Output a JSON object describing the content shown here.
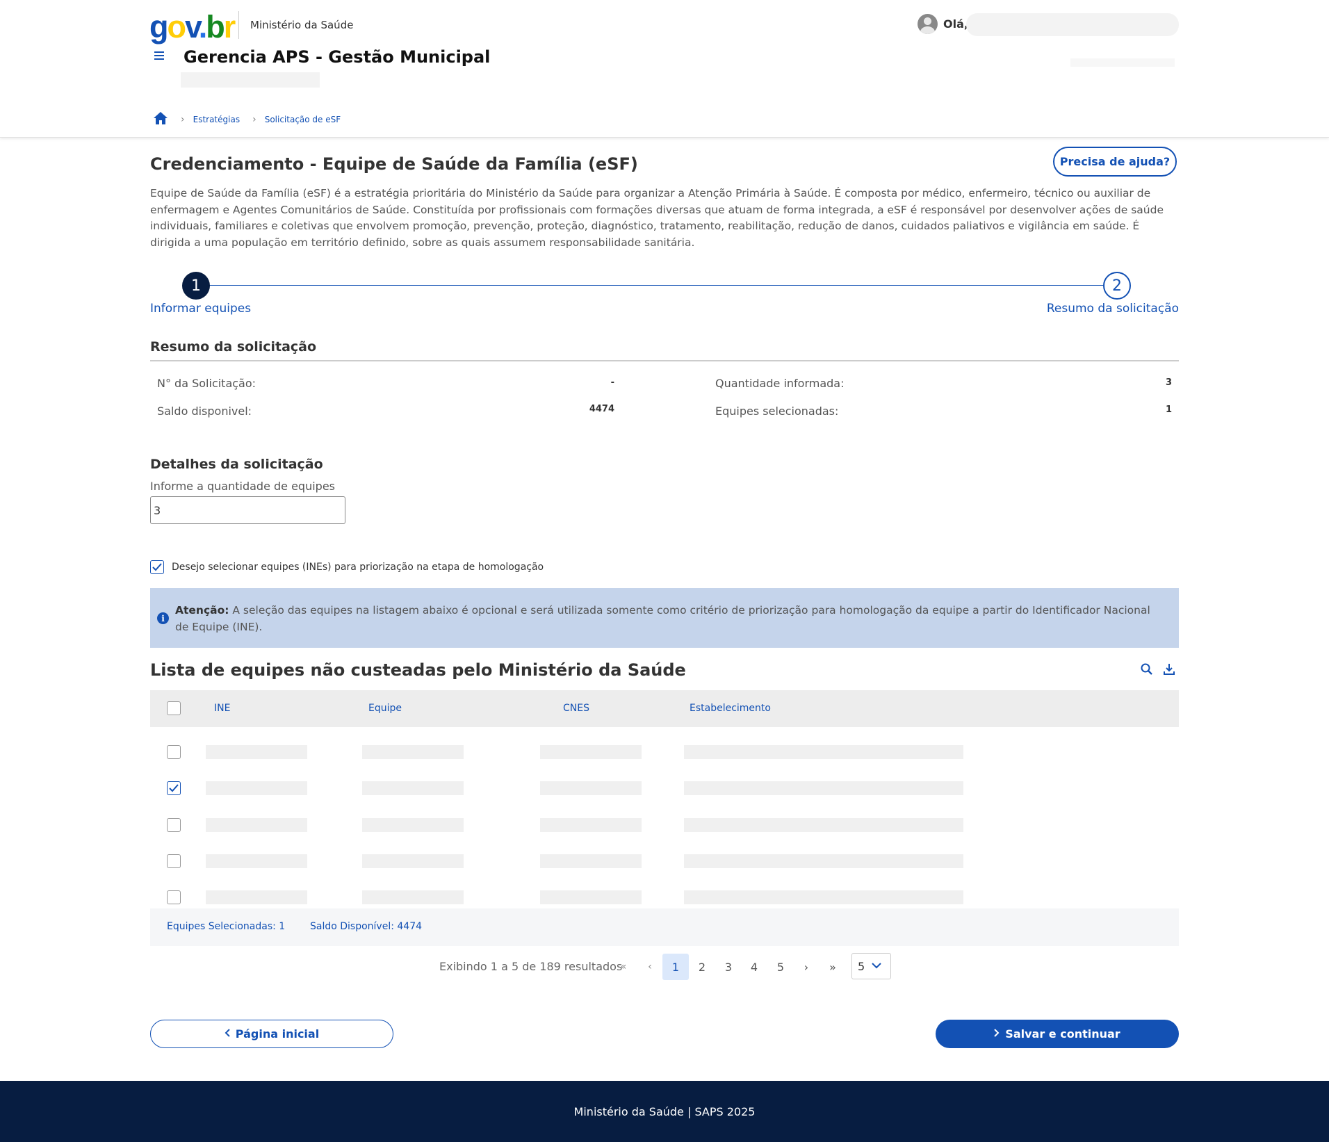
{
  "header": {
    "logo": {
      "g": "g",
      "o": "o",
      "v": "v",
      "dot": ".",
      "b": "b",
      "r": "r"
    },
    "org": "Ministério da Saúde",
    "greeting": "Olá,",
    "app_title": "Gerencia APS - Gestão Municipal",
    "menu_icon": "hamburger-icon",
    "breadcrumb": [
      "Estratégias",
      "Solicitação de eSF"
    ]
  },
  "page": {
    "title": "Credenciamento - Equipe de Saúde da Família (eSF)",
    "help_button": "Precisa de ajuda?",
    "description": "Equipe de Saúde da Família (eSF) é a estratégia prioritária do Ministério da Saúde para organizar a Atenção Primária à Saúde. É composta por médico, enfermeiro, técnico ou auxiliar de enfermagem e Agentes Comunitários de Saúde. Constituída por profissionais com formações diversas que atuam de forma integrada, a eSF é responsável por desenvolver ações de saúde individuais, familiares e coletivas que envolvem promoção, prevenção, proteção, diagnóstico, tratamento, reabilitação, redução de danos, cuidados paliativos e vigilância em saúde. É dirigida a uma população em território definido, sobre as quais assumem responsabilidade sanitária."
  },
  "stepper": {
    "steps": [
      {
        "number": "1",
        "label": "Informar equipes",
        "active": true
      },
      {
        "number": "2",
        "label": "Resumo da solicitação",
        "active": false
      }
    ]
  },
  "summary": {
    "title": "Resumo da solicitação",
    "request_number_label": "N° da Solicitação:",
    "request_number_value": "-",
    "balance_label": "Saldo disponivel:",
    "balance_value": "4474",
    "informed_label": "Quantidade informada:",
    "informed_value": "3",
    "selected_label": "Equipes selecionadas:",
    "selected_value": "1"
  },
  "details": {
    "title": "Detalhes da solicitação",
    "quantity_label": "Informe a quantidade de equipes",
    "quantity_value": "3",
    "prioritize_label": "Desejo selecionar equipes (INEs) para priorização na etapa de homologação",
    "prioritize_checked": true
  },
  "alert": {
    "icon": "info-icon",
    "bold": "Atenção:",
    "text": " A seleção das equipes na listagem abaixo é opcional e será utilizada somente como critério de priorização para homologação da equipe a partir do Identificador Nacional de Equipe (INE)."
  },
  "list": {
    "title": "Lista de equipes não custeadas pelo Ministério da Saúde",
    "icons": [
      "search-icon",
      "download-icon"
    ],
    "columns": [
      "INE",
      "Equipe",
      "CNES",
      "Estabelecimento"
    ],
    "rows": [
      {
        "checked": false
      },
      {
        "checked": true
      },
      {
        "checked": false
      },
      {
        "checked": false
      },
      {
        "checked": false
      }
    ],
    "footer_selected": "Equipes Selecionadas: 1",
    "footer_balance": "Saldo Disponível: 4474"
  },
  "pagination": {
    "info": "Exibindo 1 a 5 de 189 resultados",
    "first": "«",
    "prev": "‹",
    "pages": [
      "1",
      "2",
      "3",
      "4",
      "5"
    ],
    "current": "1",
    "next": "›",
    "last": "»",
    "page_size": "5"
  },
  "actions": {
    "back": "Página inicial",
    "save": "Salvar e continuar"
  },
  "footer": {
    "text": "Ministério da Saúde | SAPS 2025"
  },
  "colors": {
    "primary": "#1351b4",
    "dark": "#071d41",
    "alert_bg": "#c5d4eb"
  }
}
